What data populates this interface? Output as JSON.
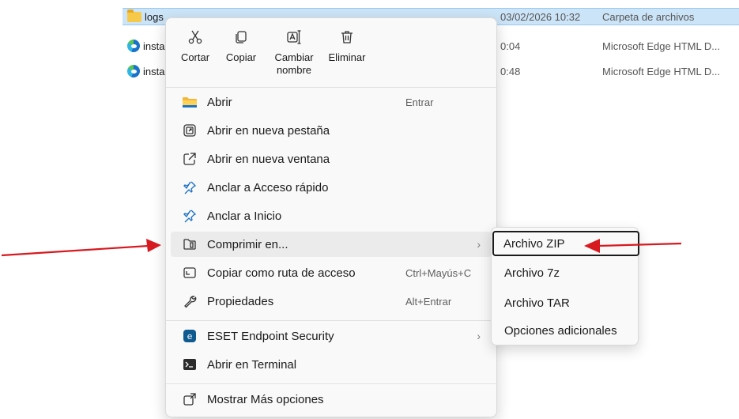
{
  "files": [
    {
      "name": "logs",
      "date": "03/02/2026 10:32",
      "type": "Carpeta de archivos",
      "icon": "folder-icon"
    },
    {
      "name": "insta",
      "date": "0:04",
      "type": "Microsoft Edge HTML D...",
      "icon": "edge-icon"
    },
    {
      "name": "insta",
      "date": "0:48",
      "type": "Microsoft Edge HTML D...",
      "icon": "edge-icon"
    }
  ],
  "toolbar": {
    "cut": "Cortar",
    "copy": "Copiar",
    "rename_line1": "Cambiar",
    "rename_line2": "nombre",
    "delete": "Eliminar"
  },
  "menu": {
    "open": {
      "label": "Abrir",
      "shortcut": "Entrar"
    },
    "open_tab": {
      "label": "Abrir en nueva pestaña"
    },
    "open_window": {
      "label": "Abrir en nueva ventana"
    },
    "pin_quick": {
      "label": "Anclar a Acceso rápido"
    },
    "pin_start": {
      "label": "Anclar a Inicio"
    },
    "compress": {
      "label": "Comprimir en..."
    },
    "copy_path": {
      "label": "Copiar como ruta de acceso",
      "shortcut": "Ctrl+Mayús+C"
    },
    "properties": {
      "label": "Propiedades",
      "shortcut": "Alt+Entrar"
    },
    "eset": {
      "label": "ESET Endpoint Security"
    },
    "terminal": {
      "label": "Abrir en Terminal"
    },
    "more": {
      "label": "Mostrar Más opciones"
    }
  },
  "submenu": {
    "zip": "Archivo ZIP",
    "sevenz": "Archivo 7z",
    "tar": "Archivo TAR",
    "more": "Opciones adicionales"
  },
  "colors": {
    "arrow": "#d71920",
    "selection": "#cce4f7",
    "accent": "#0067c0"
  }
}
